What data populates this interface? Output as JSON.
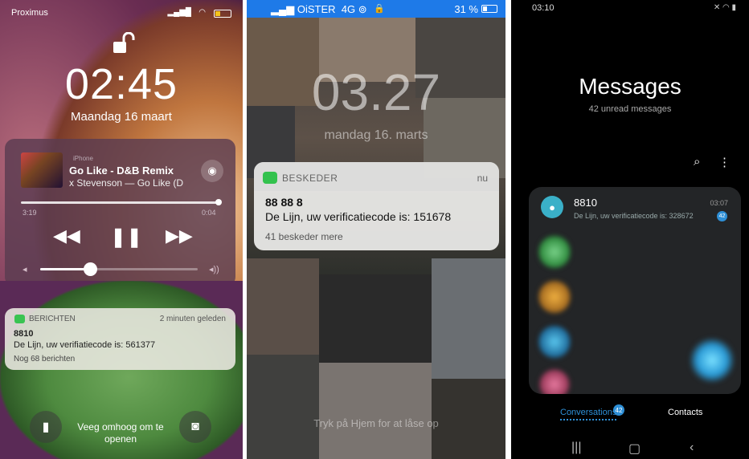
{
  "screen1": {
    "status": {
      "carrier": "Proximus"
    },
    "time": "02:45",
    "date": "Maandag 16 maart",
    "player": {
      "source": "iPhone",
      "title": "Go Like - D&B Remix",
      "artist": "x Stevenson — Go Like (D",
      "elapsed": "3:19",
      "remaining": "0:04",
      "progress": 0.98,
      "volume": 0.3
    },
    "notification": {
      "app": "BERICHTEN",
      "when": "2 minuten geleden",
      "sender": "8810",
      "body": "De Lijn, uw verifiatiecode is: 561377",
      "more": "Nog 68 berichten"
    },
    "swipe_hint": "Veeg omhoog om te openen"
  },
  "screen2": {
    "status": {
      "carrier": "OiSTER",
      "network": "4G",
      "battery": "31 %"
    },
    "time": "03.27",
    "date": "mandag 16. marts",
    "notification": {
      "app": "BESKEDER",
      "when": "nu",
      "sender": "88 88 8",
      "body": "De Lijn, uw verificatiecode is: 151678",
      "more": "41 beskeder mere"
    },
    "hint": "Tryk på Hjem for at låse op"
  },
  "screen3": {
    "status": {
      "time": "03:10"
    },
    "title": "Messages",
    "subtitle": "42 unread messages",
    "conversation": {
      "name": "8810",
      "snippet": "De Lijn, uw verificatiecode is: 328672",
      "when": "03:07",
      "badge": "42"
    },
    "tabs": {
      "conversations": "Conversations",
      "contacts": "Contacts",
      "badge": "42"
    }
  }
}
